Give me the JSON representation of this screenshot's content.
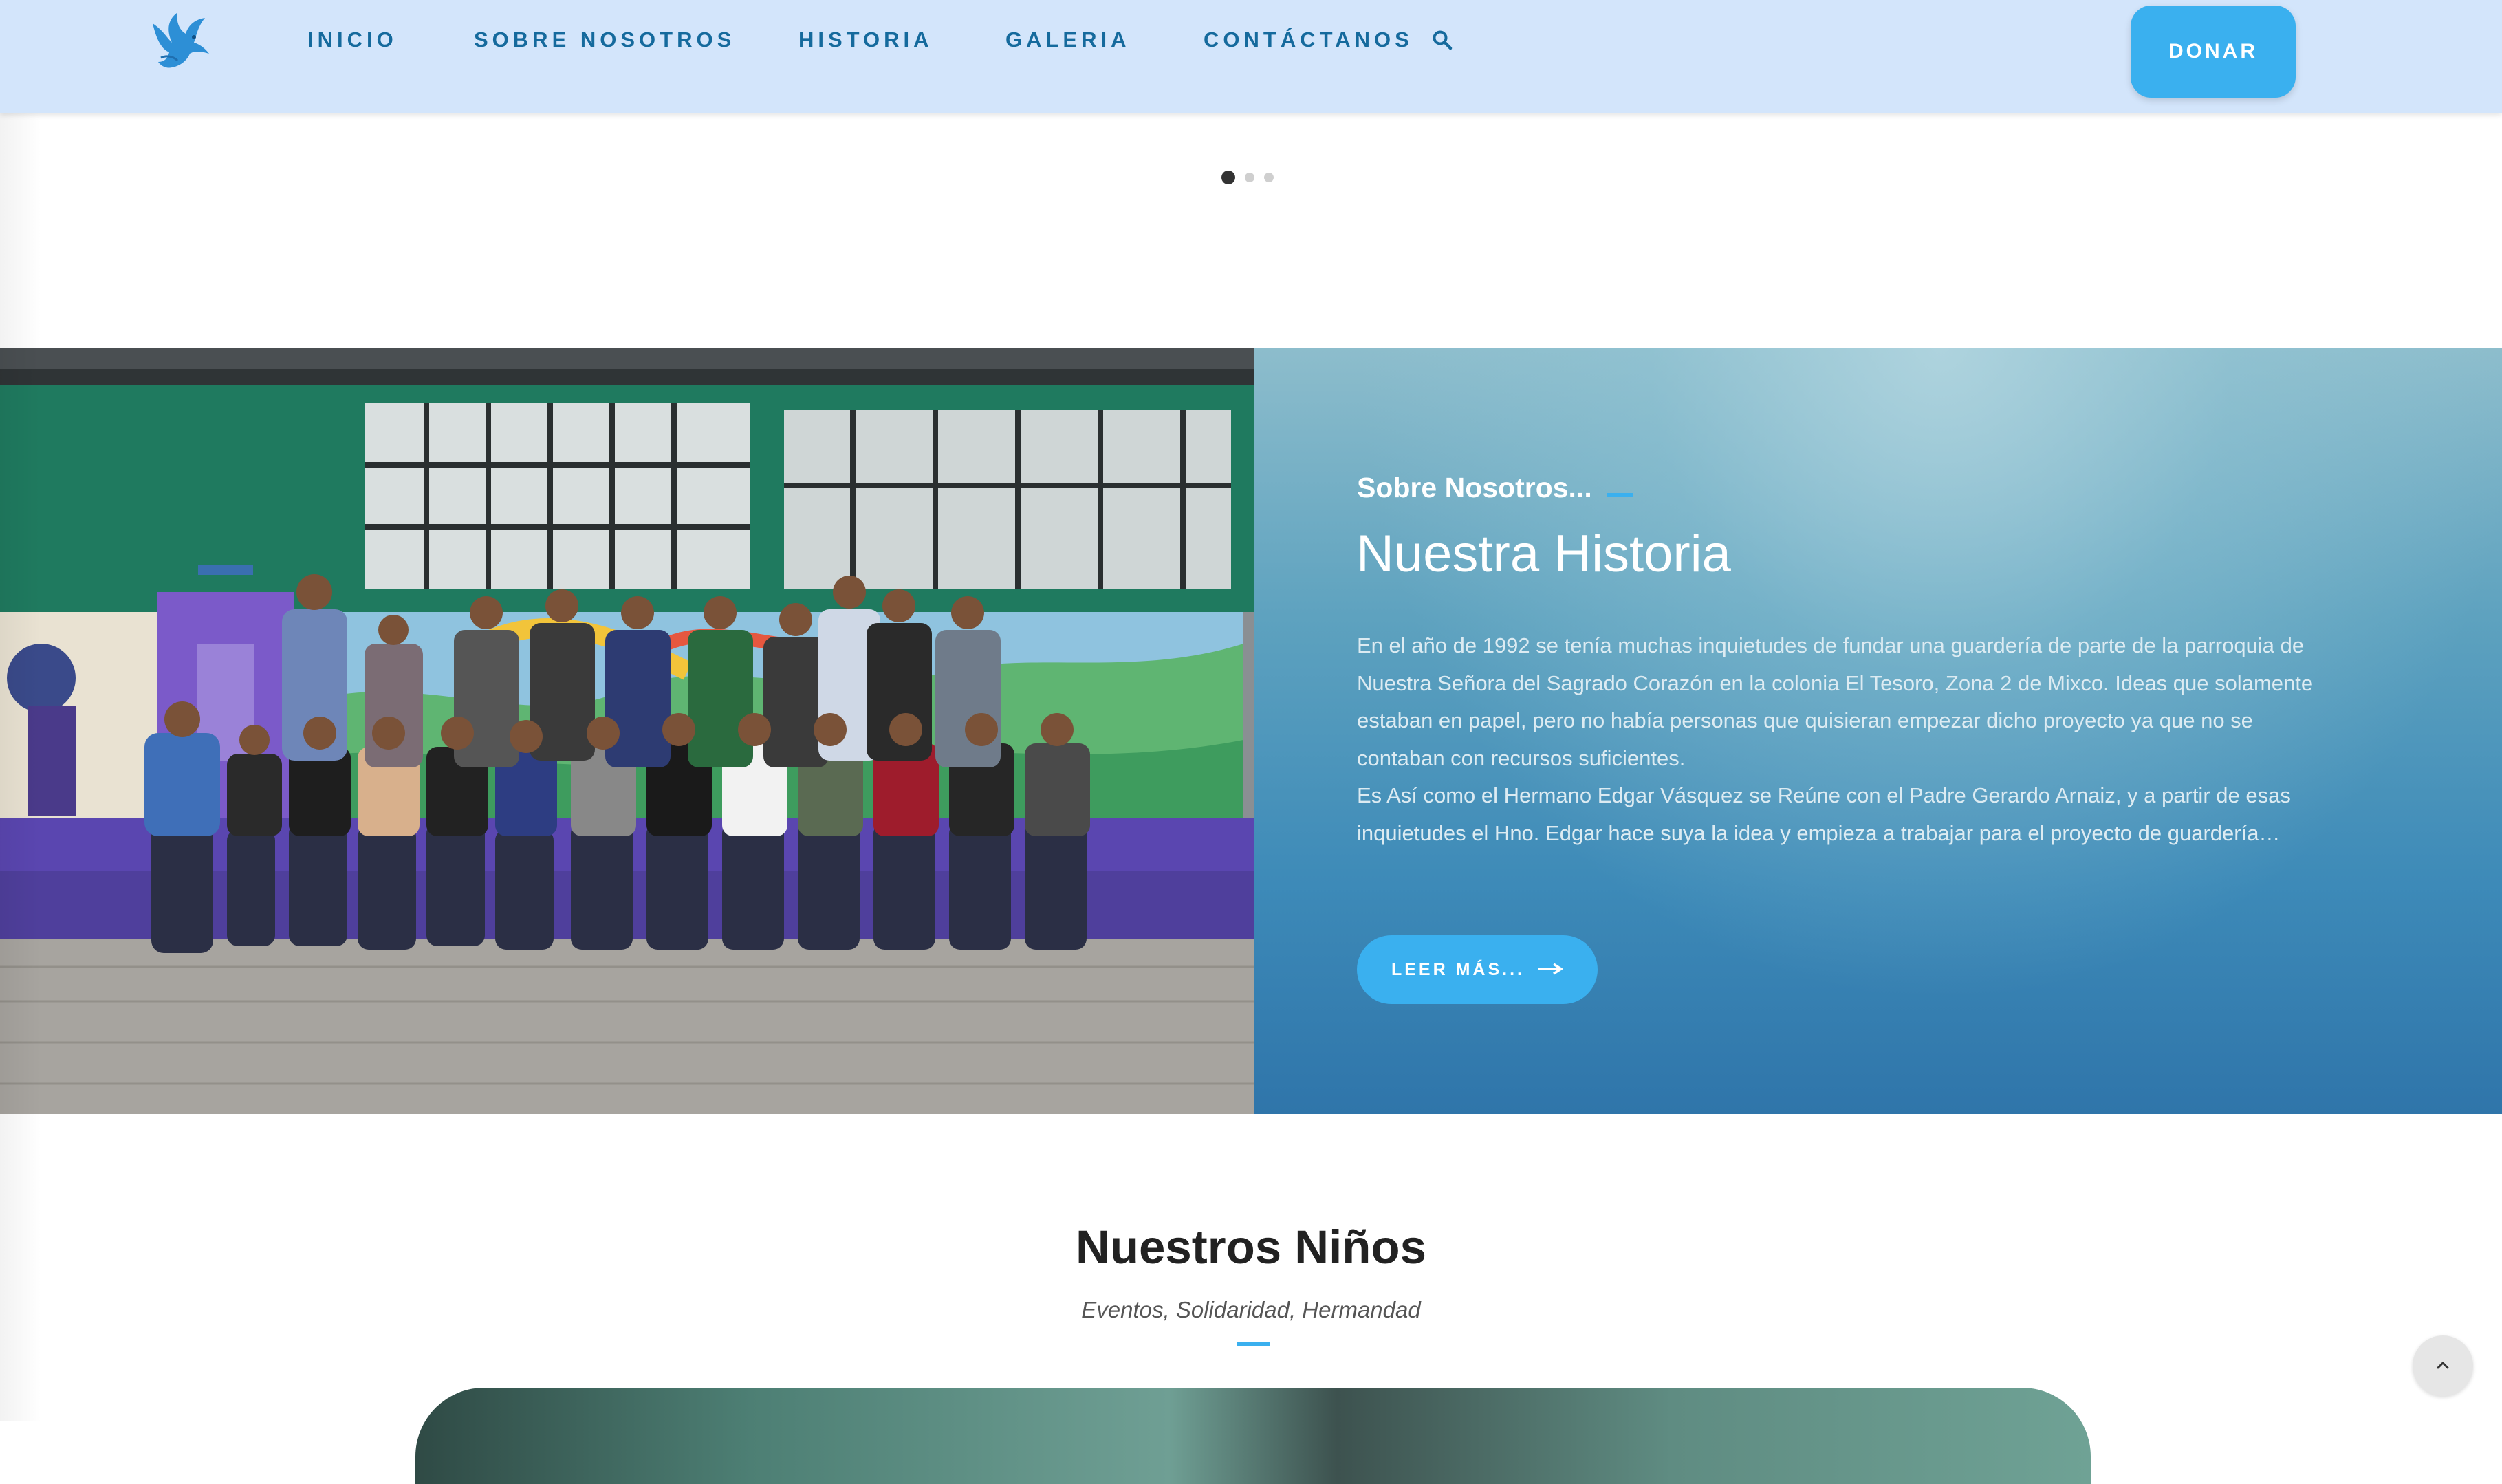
{
  "header": {
    "logo_icon": "dove-icon",
    "nav": [
      {
        "label": "INICIO"
      },
      {
        "label": "SOBRE NOSOTROS"
      },
      {
        "label": "HISTORIA"
      },
      {
        "label": "GALERIA"
      },
      {
        "label": "CONTÁCTANOS"
      }
    ],
    "search_icon": "search-icon",
    "donate_label": "DONAR"
  },
  "slider": {
    "dots": 3,
    "active": 1
  },
  "about": {
    "kicker": "Sobre Nosotros...",
    "title": "Nuestra Historia",
    "paragraph1": "En el año de 1992 se tenía muchas inquietudes de fundar una guardería de parte de la parroquia de Nuestra Señora del Sagrado Corazón en la colonia El Tesoro, Zona 2 de Mixco. Ideas que solamente estaban en papel, pero no había personas que quisieran empezar dicho proyecto ya que no se contaban con recursos suficientes.",
    "paragraph2": "Es Así como el Hermano Edgar Vásquez se Reúne con el Padre Gerardo Arnaiz, y a partir de esas inquietudes el Hno. Edgar hace suya la idea y empieza a trabajar para el proyecto de guardería…",
    "read_more": "LEER MÁS...",
    "read_more_icon": "arrow-right-icon"
  },
  "kids": {
    "title": "Nuestros Niños",
    "subtitle": "Eventos, Solidaridad, Hermandad"
  },
  "scroll_top_icon": "chevron-up-icon",
  "colors": {
    "header_bg": "#d3e5fb",
    "nav_text": "#156a9d",
    "accent": "#3ab0ef"
  }
}
